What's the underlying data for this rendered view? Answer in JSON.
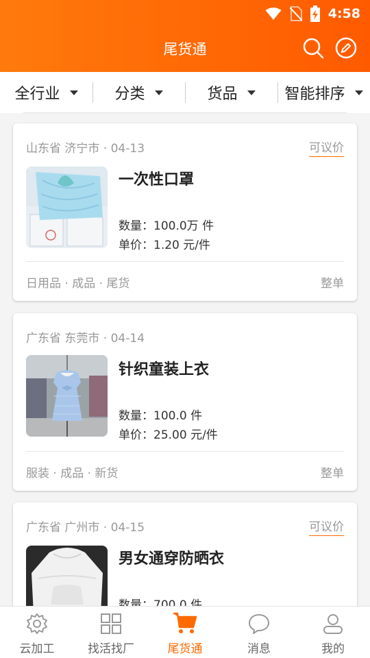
{
  "status_bar": {
    "time": "4:58"
  },
  "header": {
    "title": "尾货通",
    "search_icon": "search-icon",
    "edit_icon": "edit-icon"
  },
  "filters": [
    {
      "label": "全行业"
    },
    {
      "label": "分类"
    },
    {
      "label": "货品"
    },
    {
      "label": "智能排序"
    }
  ],
  "listings": [
    {
      "location": "山东省 济宁市 · 04-13",
      "badge": "可议价",
      "title": "一次性口罩",
      "quantity": "数量：100.0万 件",
      "unit_price": "单价：1.20 元/件",
      "tags": "日用品 · 成品 · 尾货",
      "order_type": "整单"
    },
    {
      "location": "广东省 东莞市 · 04-14",
      "badge": "",
      "title": "针织童装上衣",
      "quantity": "数量：100.0 件",
      "unit_price": "单价：25.00 元/件",
      "tags": "服装 · 成品 · 新货",
      "order_type": "整单"
    },
    {
      "location": "广东省 广州市 · 04-15",
      "badge": "可议价",
      "title": "男女通穿防晒衣",
      "quantity": "数量：700.0 件",
      "unit_price": "",
      "tags": "",
      "order_type": ""
    }
  ],
  "tab_bar": [
    {
      "label": "云加工",
      "icon": "gear-icon"
    },
    {
      "label": "找活找厂",
      "icon": "grid-icon"
    },
    {
      "label": "尾货通",
      "icon": "cart-icon",
      "active": true
    },
    {
      "label": "消息",
      "icon": "chat-bubble-icon"
    },
    {
      "label": "我的",
      "icon": "user-icon"
    }
  ],
  "colors": {
    "accent": "#ff6a00",
    "header_start": "#ff7a0c",
    "header_end": "#ff5a00"
  }
}
